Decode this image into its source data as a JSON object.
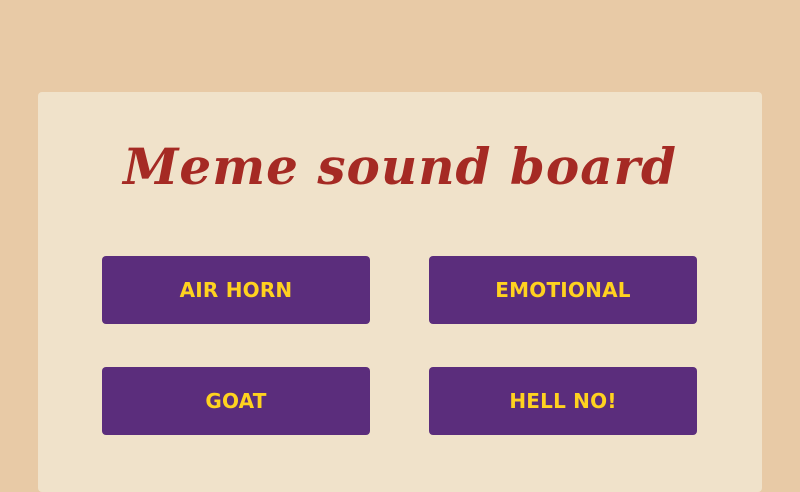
{
  "title": "Meme sound board",
  "buttons": [
    {
      "label": "AIR HORN"
    },
    {
      "label": "EMOTIONAL"
    },
    {
      "label": "GOAT"
    },
    {
      "label": "HELL NO!"
    }
  ],
  "colors": {
    "background": "#e8caa6",
    "panel": "#f0e2ca",
    "title": "#a52a24",
    "button_bg": "#5b2d7c",
    "button_text": "#ffd21f"
  }
}
